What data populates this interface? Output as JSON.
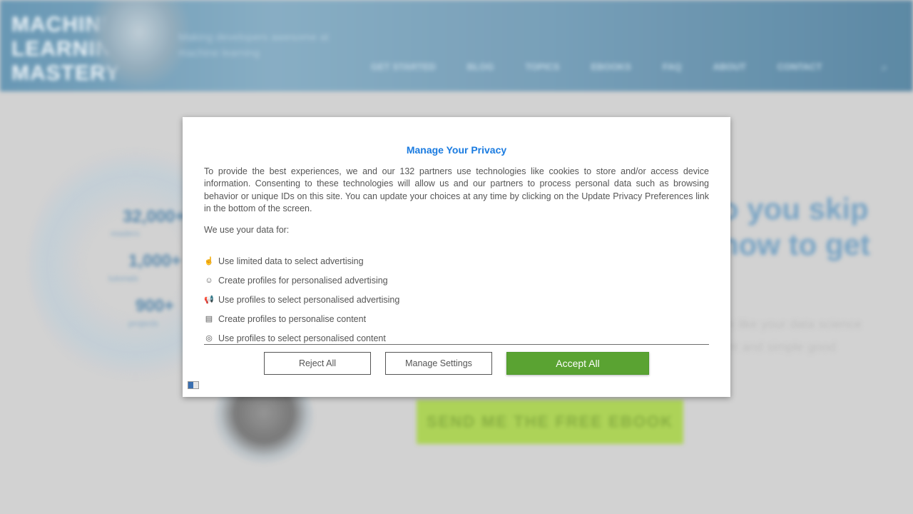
{
  "background": {
    "logo_lines": [
      "MACHINE",
      "LEARNING",
      "MASTERY"
    ],
    "tagline": "Making developers awesome at machine learning",
    "nav": [
      "GET STARTED",
      "BLOG",
      "TOPICS",
      "EBOOKS",
      "FAQ",
      "ABOUT",
      "CONTACT"
    ],
    "stats": [
      {
        "value": "32,000+",
        "label": "readers"
      },
      {
        "value": "1,000+",
        "label": "tutorials"
      },
      {
        "value": "900+",
        "label": "projects"
      }
    ],
    "headline": [
      "o you skip",
      "how to get"
    ],
    "lead": [
      "en like your data science",
      "ent and simple good"
    ],
    "cta": "SEND ME THE FREE EBOOK"
  },
  "modal": {
    "title": "Manage Your Privacy",
    "intro": "To provide the best experiences, we and our 132 partners use technologies like cookies to store and/or access device information. Consenting to these technologies will allow us and our partners to process personal data such as browsing behavior or unique IDs on this site. You can update your choices at any time by clicking on the Update Privacy Preferences link in the bottom of the screen.",
    "use_label": "We use your data for:",
    "purposes": [
      {
        "icon": "hand-pointer-icon",
        "glyph": "☝",
        "label": "Use limited data to select advertising"
      },
      {
        "icon": "face-icon",
        "glyph": "☺",
        "label": "Create profiles for personalised advertising"
      },
      {
        "icon": "megaphone-icon",
        "glyph": "📢",
        "label": "Use profiles to select personalised advertising"
      },
      {
        "icon": "document-icon",
        "glyph": "▤",
        "label": "Create profiles to personalise content"
      },
      {
        "icon": "target-icon",
        "glyph": "◎",
        "label": "Use profiles to select personalised content"
      }
    ],
    "buttons": {
      "reject": "Reject All",
      "manage": "Manage Settings",
      "accept": "Accept All"
    },
    "colors": {
      "title": "#1a7be0",
      "accept": "#5aa332"
    }
  }
}
